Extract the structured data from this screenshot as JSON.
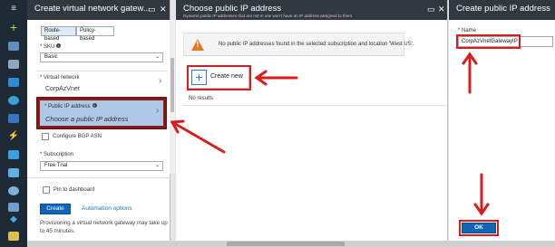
{
  "left_nav": {
    "icons": [
      "hamburger-icon",
      "plus-icon",
      "grid-icon",
      "list-icon",
      "cube-icon",
      "globe-icon",
      "database-icon",
      "lightning-icon",
      "monitor-icon",
      "satellite-icon",
      "clock-icon",
      "shield-icon",
      "diamond-icon",
      "panel-icon"
    ]
  },
  "blade1": {
    "title": "Create virtual network gatew...",
    "gateway_type_options": [
      "Route-based",
      "Policy-based"
    ],
    "gateway_type_selected": "Route-based",
    "sku_label": "SKU",
    "sku_value": "Basic",
    "vnet_label": "Virtual network",
    "vnet_value": "CorpAzVnet",
    "public_ip_label": "Public IP address",
    "public_ip_placeholder": "Choose a public IP address",
    "bgp_label": "Configure BGP ASN",
    "subscription_label": "Subscription",
    "subscription_value": "Free Trial",
    "pin_label": "Pin to dashboard",
    "create_label": "Create",
    "automation_label": "Automation options",
    "footer_text": "Provisioning a virtual network gateway may take up to 45 minutes."
  },
  "blade2": {
    "title": "Choose public IP address",
    "subtitle": "Dynamic public IP addresses that are not in use won't have an IP address assigned to them.",
    "notice": "No public IP addresses found in the selected subscription and location 'West US'.",
    "create_new_label": "Create new",
    "empty_text": "No results"
  },
  "blade3": {
    "title": "Create public IP address",
    "name_label": "Name",
    "name_value": "CorpAzVnetGatewayIP",
    "ok_label": "OK"
  },
  "colors": {
    "header": "#32383f",
    "accent": "#0f66b6",
    "highlight": "#d91c1c",
    "selected_field": "#aec8e6"
  }
}
